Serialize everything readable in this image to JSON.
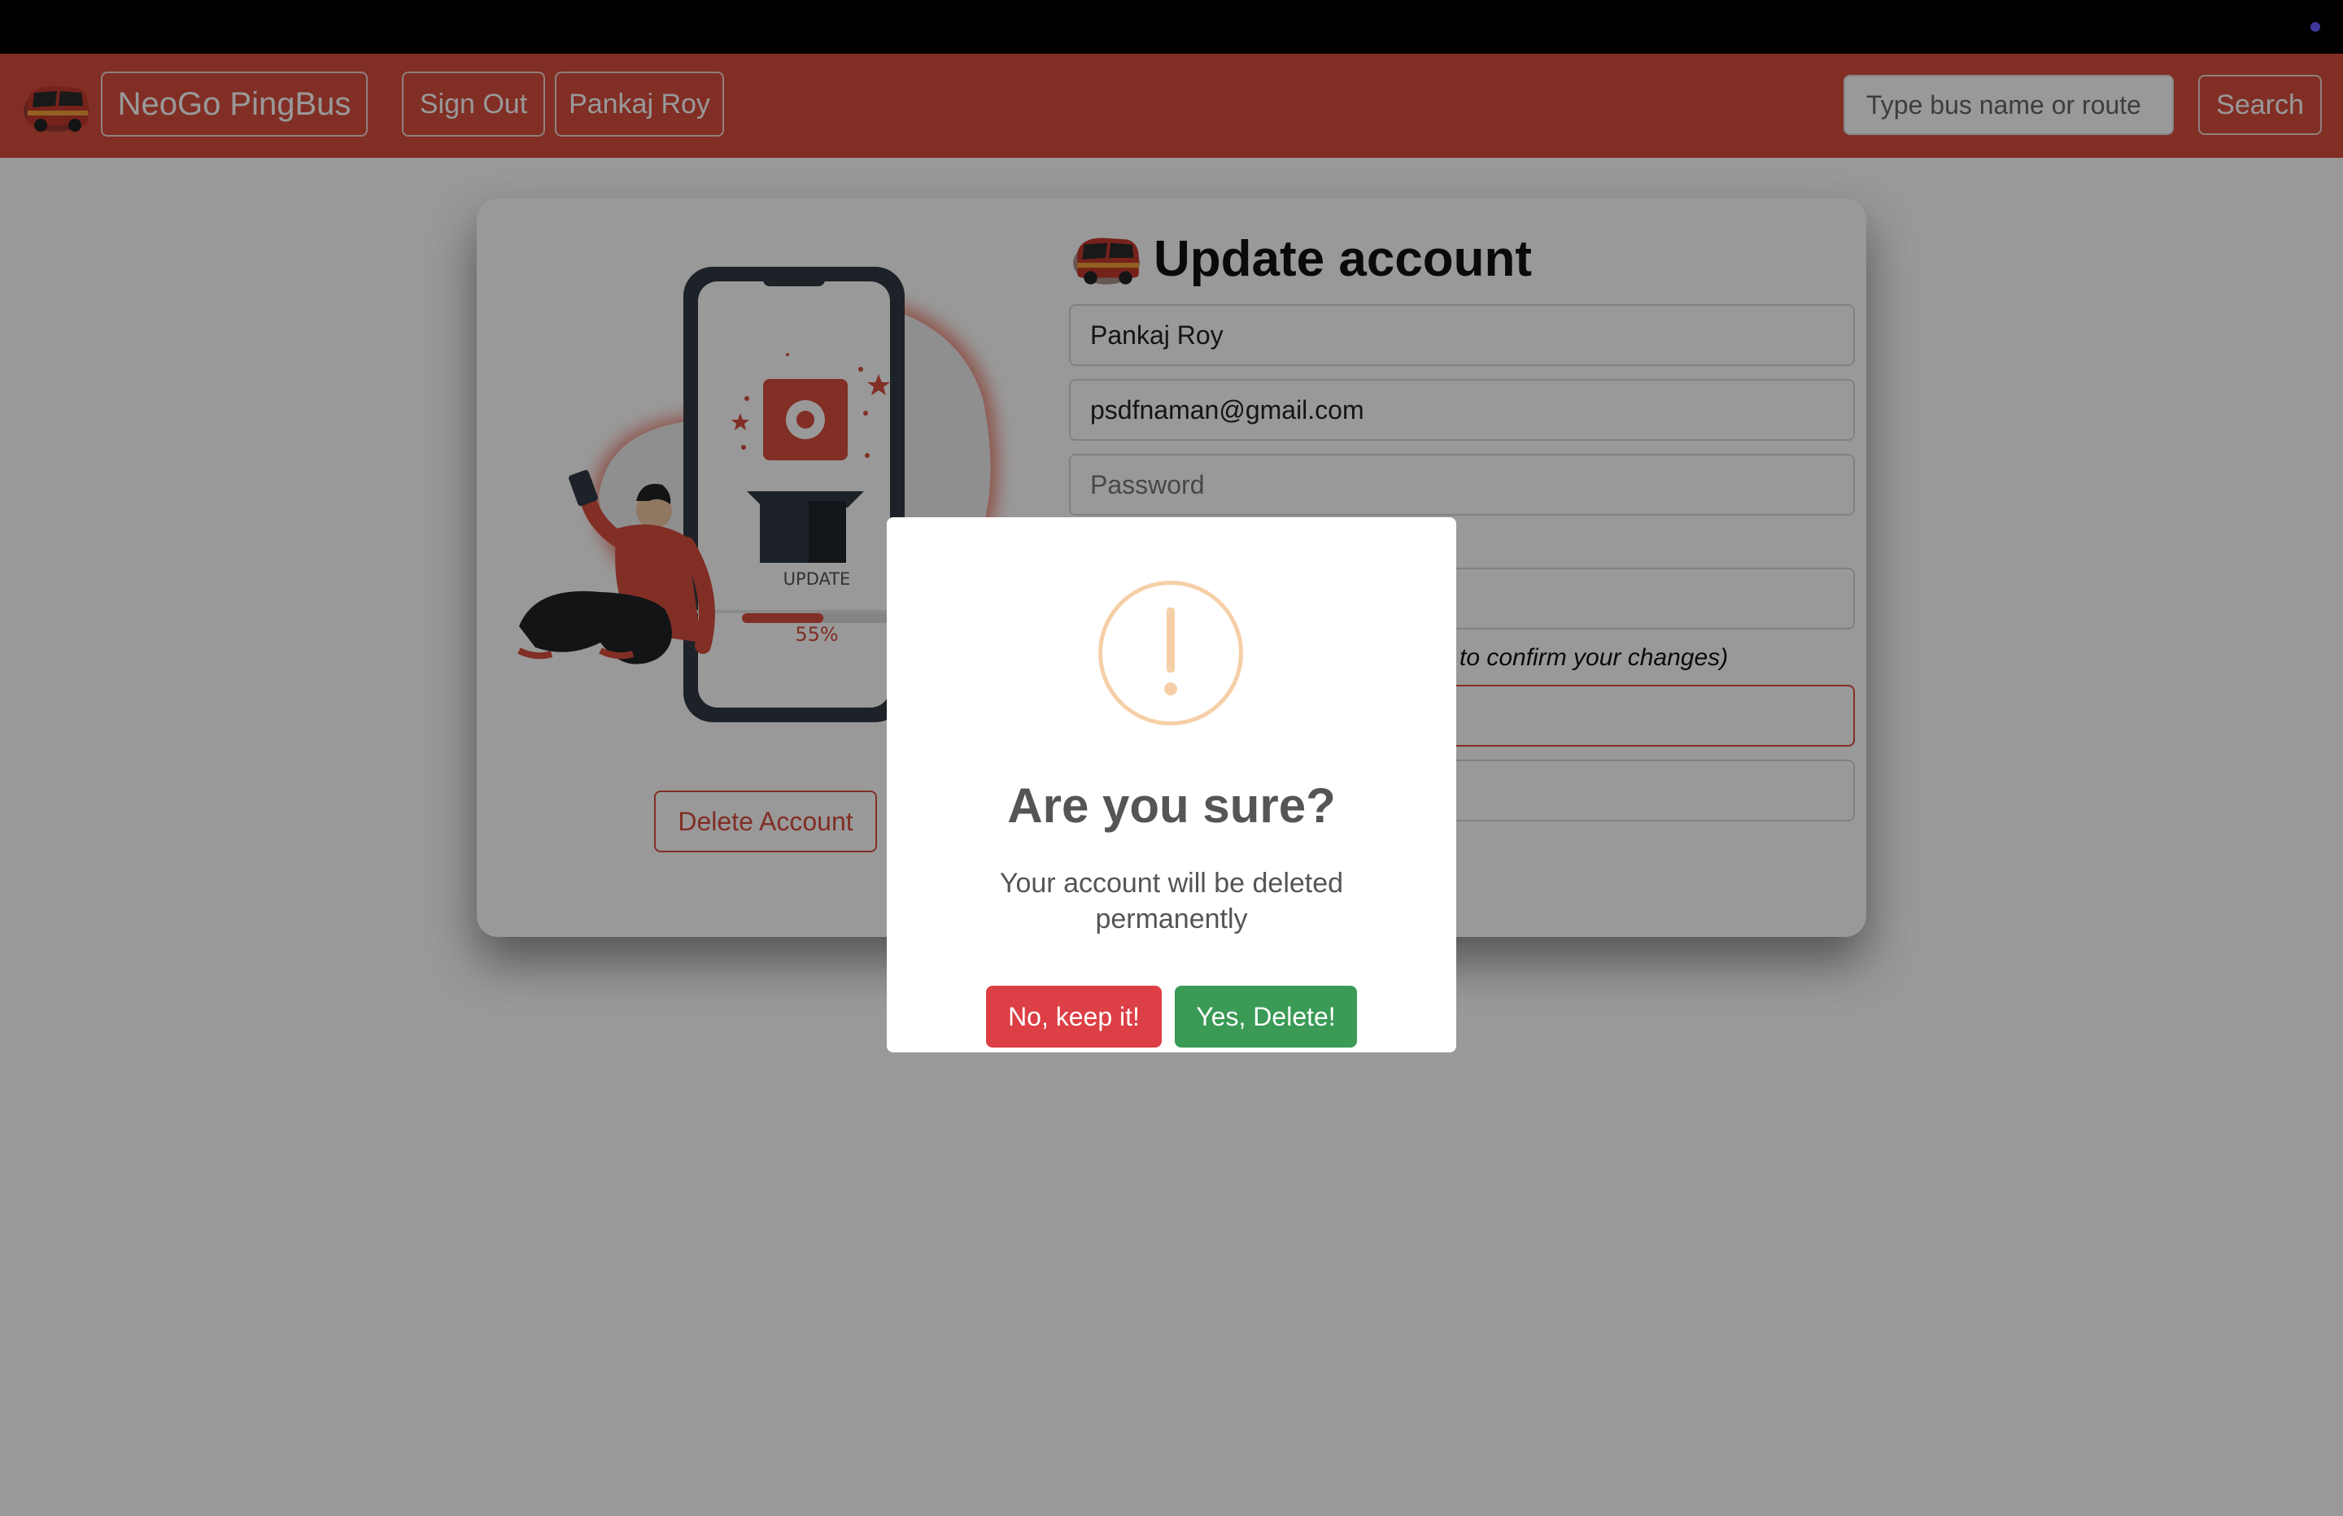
{
  "navbar": {
    "brand": "NeoGo PingBus",
    "sign_out": "Sign Out",
    "user_name": "Pankaj Roy",
    "search_placeholder": "Type bus name or route",
    "search_button": "Search"
  },
  "card": {
    "title": "Update account",
    "illustration": {
      "label": "UPDATE",
      "progress_text": "55%",
      "progress": 0.55
    },
    "delete_button": "Delete Account",
    "fields": {
      "name": "Pankaj Roy",
      "email": "psdfnaman@gmail.com",
      "password_placeholder": "Password"
    },
    "confirm_note": "to confirm your changes)"
  },
  "modal": {
    "icon": "exclamation-icon",
    "title": "Are you sure?",
    "text": "Your account will be deleted permanently",
    "no_button": "No, keep it!",
    "yes_button": "Yes, Delete!"
  },
  "colors": {
    "navbar": "#d84d3f",
    "no_button": "#dc3f45",
    "yes_button": "#3a9a56",
    "warning": "#f6cfa8"
  }
}
